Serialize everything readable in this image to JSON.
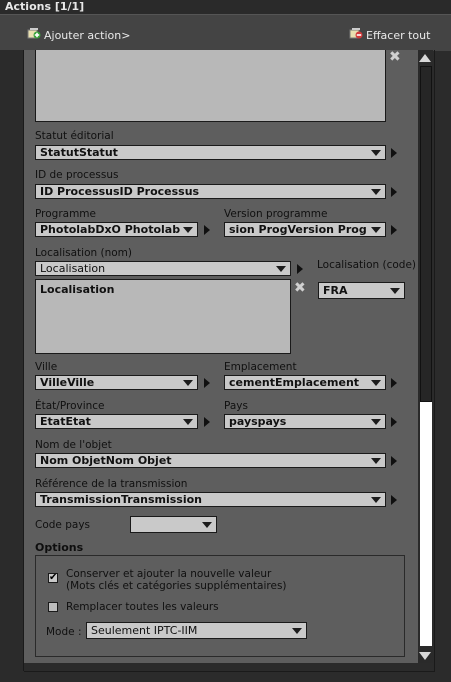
{
  "title": "Actions [1/1]",
  "toolbar": {
    "add_label": "Ajouter action>",
    "clear_label": "Effacer tout"
  },
  "fields": {
    "statut_label": "Statut éditorial",
    "statut_value": "StatutStatut",
    "processus_label": "ID de processus",
    "processus_value": "ID ProcessusID Processus",
    "programme_label": "Programme",
    "programme_value": "PhotolabDxO Photolab",
    "version_label": "Version programme",
    "version_value": "sion ProgVersion Prog",
    "localisation_label": "Localisation (nom)",
    "localisation_select": "Localisation",
    "localisation_text": "Localisation",
    "code_label": "Localisation (code)",
    "code_value": "FRA",
    "ville_label": "Ville",
    "ville_value": "VilleVille",
    "emplacement_label": "Emplacement",
    "emplacement_value": "cementEmplacement",
    "etat_label": "État/Province",
    "etat_value": "EtatEtat",
    "pays_label": "Pays",
    "pays_value": "payspays",
    "objet_label": "Nom de l'objet",
    "objet_value": "Nom ObjetNom Objet",
    "transmission_label": "Référence de la transmission",
    "transmission_value": "TransmissionTransmission",
    "codepays_label": "Code pays",
    "codepays_value": ""
  },
  "options": {
    "heading": "Options",
    "keep_line1": "Conserver et ajouter la nouvelle valeur",
    "keep_line2": "(Mots clés et catégories supplémentaires)",
    "keep_checked": true,
    "replace_label": "Remplacer toutes les valeurs",
    "replace_checked": false,
    "mode_label": "Mode :",
    "mode_value": "Seulement IPTC-IIM"
  }
}
